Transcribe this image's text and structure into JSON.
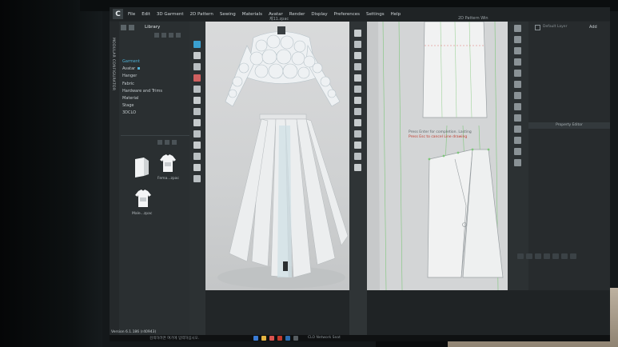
{
  "app": {
    "logo_letter": "C",
    "window_title": "제11.zpac",
    "pattern_title": "2D Pattern Win"
  },
  "menu": [
    "File",
    "Edit",
    "3D Garment",
    "2D Pattern",
    "Sewing",
    "Materials",
    "Avatar",
    "Render",
    "Display",
    "Preferences",
    "Settings",
    "Help"
  ],
  "library": {
    "title": "Library",
    "side_label": "MODULAR CONFIGURATOR",
    "tree": [
      {
        "label": "Garment",
        "active": true
      },
      {
        "label": "Avatar",
        "active": false
      },
      {
        "label": "Hanger",
        "active": false
      },
      {
        "label": "Fabric",
        "active": false
      },
      {
        "label": "Hardware and Trims",
        "active": false
      },
      {
        "label": "Material",
        "active": false
      },
      {
        "label": "Stage",
        "active": false
      },
      {
        "label": "3DCLO",
        "active": false
      }
    ],
    "thumbnails": [
      {
        "label": "Fema...zpac"
      },
      {
        "label": "Male...zpac"
      }
    ],
    "version": "Version 6.1.186 (r40943)"
  },
  "pattern": {
    "message_line1": "Press Enter for completion. Lasting",
    "message_line2": "Press Esc to cancel Line drawing"
  },
  "right_panel": {
    "add_label": "Add",
    "layer_label": "Default Layer",
    "property_header": "Property Editor"
  },
  "taskbar": {
    "search_placeholder": "검색하려면 여기에 입력하십시오.",
    "active_title": "CLO Network Seat"
  },
  "colors": {
    "accent": "#4fb1d6",
    "menubar": "#1f2325",
    "panel": "#2a2f31",
    "viewport3d": "#d9dadb",
    "viewport2d": "#d3d5d6",
    "pattern_green": "#7fc77b",
    "pattern_red": "#d9534f"
  }
}
